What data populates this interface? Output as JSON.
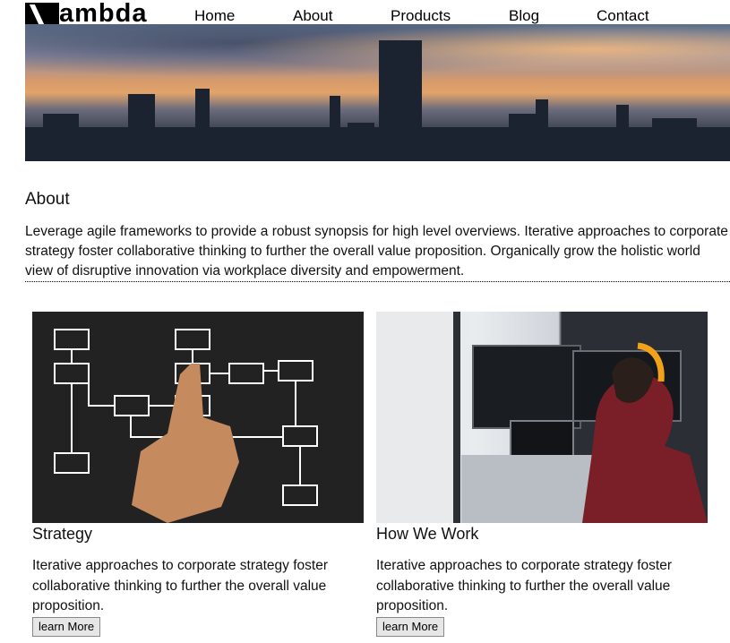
{
  "brand": {
    "logo_text": "ambda"
  },
  "nav": [
    "Home",
    "About",
    "Products",
    "Blog",
    "Contact"
  ],
  "about": {
    "title": "About",
    "text": "Leverage agile frameworks to provide a robust synopsis for high level overviews. Iterative approaches to corporate strategy foster collaborative thinking to further the overall value proposition. Organically grow the holistic world view of disruptive innovation via workplace diversity and empowerment."
  },
  "cards": [
    {
      "title": "Strategy",
      "text": "Iterative approaches to corporate strategy foster collaborative thinking to further the overall value proposition.",
      "button": "learn More"
    },
    {
      "title": "How We Work",
      "text": "Iterative approaches to corporate strategy foster collaborative thinking to further the overall value proposition.",
      "button": "learn More"
    }
  ]
}
